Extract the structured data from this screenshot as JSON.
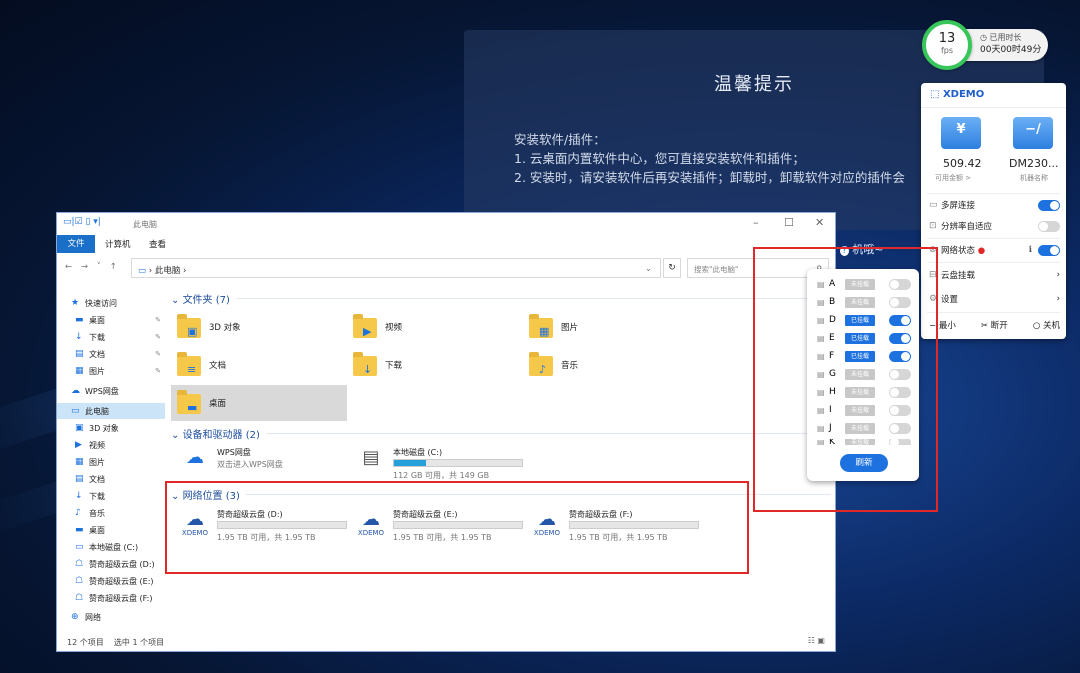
{
  "notice": {
    "title": "温馨提示",
    "lines": [
      "安装软件/插件：",
      "1. 云桌面内置软件中心，您可直接安装软件和插件；",
      "2. 安装时，请安装软件后再安装插件；卸载时，卸载软件对应的插件会"
    ]
  },
  "fps": {
    "value": "13",
    "unit": "fps",
    "uptime_label": "已用时长",
    "uptime_value": "00天00时49分"
  },
  "xdemo": {
    "logo": "XDEMO",
    "balance": "509.42",
    "balance_label": "可用金额 >",
    "machine": "DM230...",
    "machine_label": "机器名称",
    "rows": [
      {
        "label": "多屏连接",
        "on": true
      },
      {
        "label": "分辨率自适应",
        "on": false
      },
      {
        "label": "网络状态",
        "on": true
      },
      {
        "label": "云盘挂载"
      },
      {
        "label": "设置"
      }
    ],
    "bottom": [
      "最小",
      "断开",
      "关机"
    ]
  },
  "explorer": {
    "title": "此电脑",
    "ribbon": {
      "file": "文件",
      "computer": "计算机",
      "view": "查看"
    },
    "address": "此电脑",
    "search_placeholder": "搜索\"此电脑\"",
    "nav": [
      {
        "label": "快速访问",
        "icon": "star-icon",
        "top": true
      },
      {
        "label": "桌面",
        "icon": "desktop-icon",
        "pin": true
      },
      {
        "label": "下载",
        "icon": "download-icon",
        "pin": true
      },
      {
        "label": "文档",
        "icon": "document-icon",
        "pin": true
      },
      {
        "label": "图片",
        "icon": "picture-icon",
        "pin": true
      },
      {
        "label": "WPS网盘",
        "icon": "cloud-icon",
        "top": true
      },
      {
        "label": "此电脑",
        "icon": "pc-icon",
        "top": true,
        "selected": true
      },
      {
        "label": "3D 对象",
        "icon": "cube-icon"
      },
      {
        "label": "视频",
        "icon": "video-icon"
      },
      {
        "label": "图片",
        "icon": "picture-icon"
      },
      {
        "label": "文档",
        "icon": "document-icon"
      },
      {
        "label": "下载",
        "icon": "download-icon"
      },
      {
        "label": "音乐",
        "icon": "music-icon"
      },
      {
        "label": "桌面",
        "icon": "desktop-icon"
      },
      {
        "label": "本地磁盘 (C:)",
        "icon": "drive-icon"
      },
      {
        "label": "赞奇超级云盘 (D:)",
        "icon": "cloud-drive-icon"
      },
      {
        "label": "赞奇超级云盘 (E:)",
        "icon": "cloud-drive-icon"
      },
      {
        "label": "赞奇超级云盘 (F:)",
        "icon": "cloud-drive-icon"
      },
      {
        "label": "网络",
        "icon": "network-icon",
        "top": true
      }
    ],
    "folders_header": "文件夹 (7)",
    "folders": [
      {
        "label": "3D 对象",
        "icon": "cube-icon",
        "glyph": "▣"
      },
      {
        "label": "视频",
        "icon": "video-icon",
        "glyph": "▶"
      },
      {
        "label": "图片",
        "icon": "picture-icon",
        "glyph": "▦"
      },
      {
        "label": "文档",
        "icon": "document-icon",
        "glyph": "≡"
      },
      {
        "label": "下载",
        "icon": "download-icon",
        "glyph": "↓"
      },
      {
        "label": "音乐",
        "icon": "music-icon",
        "glyph": "♪"
      },
      {
        "label": "桌面",
        "icon": "desktop-icon",
        "glyph": "▬"
      }
    ],
    "devices_header": "设备和驱动器 (2)",
    "wps": {
      "name": "WPS网盘",
      "sub": "双击进入WPS网盘"
    },
    "local_disk": {
      "name": "本地磁盘 (C:)",
      "sub": "112 GB 可用，共 149 GB",
      "used_fraction": 0.25
    },
    "network_header": "网络位置 (3)",
    "net_drives": [
      {
        "name": "赞奇超级云盘 (D:)",
        "sub": "1.95 TB 可用，共 1.95 TB",
        "brand": "XDEMO"
      },
      {
        "name": "赞奇超级云盘 (E:)",
        "sub": "1.95 TB 可用，共 1.95 TB",
        "brand": "XDEMO"
      },
      {
        "name": "赞奇超级云盘 (F:)",
        "sub": "1.95 TB 可用，共 1.95 TB",
        "brand": "XDEMO"
      }
    ],
    "status_count": "12 个项目",
    "status_selected": "选中 1 个项目"
  },
  "machine_label": "机哦",
  "drive_popup": {
    "rows": [
      {
        "letter": "A",
        "tag": "未挂载",
        "on": false
      },
      {
        "letter": "B",
        "tag": "未挂载",
        "on": false
      },
      {
        "letter": "D",
        "tag": "已挂载",
        "on": true
      },
      {
        "letter": "E",
        "tag": "已挂载",
        "on": true
      },
      {
        "letter": "F",
        "tag": "已挂载",
        "on": true
      },
      {
        "letter": "G",
        "tag": "未挂载",
        "on": false
      },
      {
        "letter": "H",
        "tag": "未挂载",
        "on": false
      },
      {
        "letter": "I",
        "tag": "未挂载",
        "on": false
      },
      {
        "letter": "J",
        "tag": "未挂载",
        "on": false
      },
      {
        "letter": "K",
        "tag": "未挂载",
        "on": false
      }
    ],
    "refresh": "刷新"
  },
  "colors": {
    "accent": "#1e72e0",
    "highlight": "#e02828",
    "fps_ring": "#38c55a"
  }
}
